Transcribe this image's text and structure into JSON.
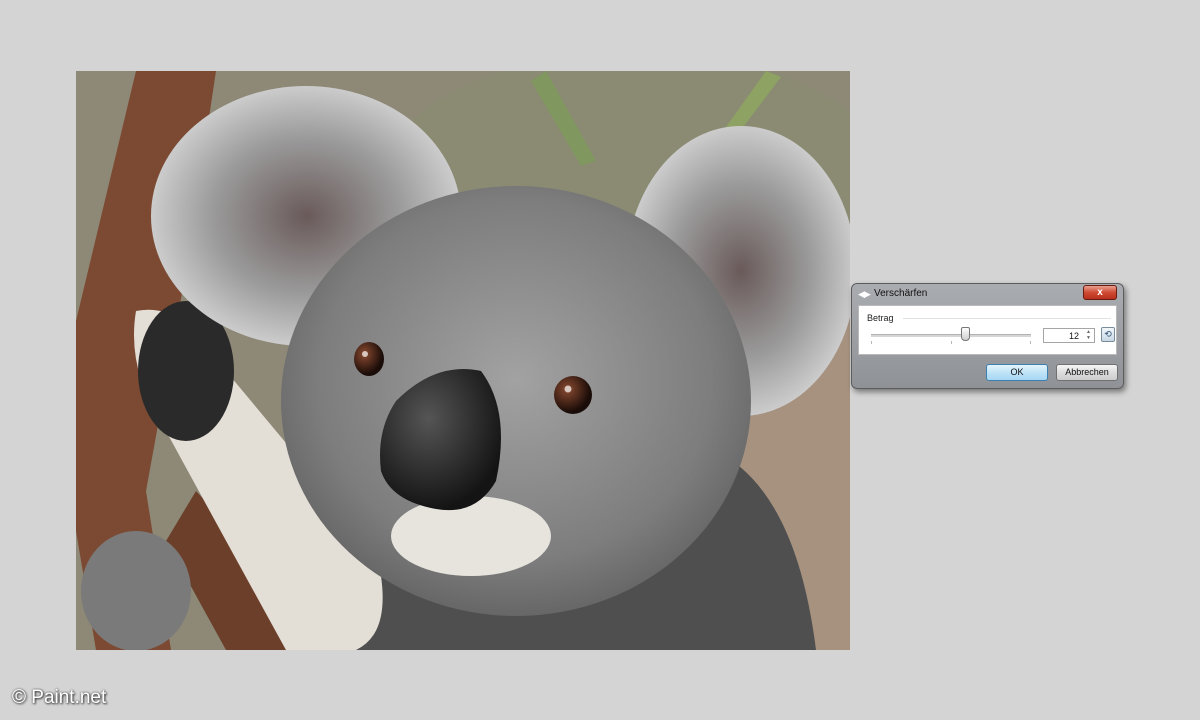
{
  "dialog": {
    "title": "Verschärfen",
    "title_icon": "sharpen-icon",
    "close_label": "x",
    "amount_label": "Betrag",
    "amount_value": "12",
    "amount_fraction": 0.59,
    "reset_icon": "reset-icon",
    "ok_label": "OK",
    "cancel_label": "Abbrechen"
  },
  "canvas": {
    "image_subject": "koala photo"
  },
  "watermark": "© Paint.net",
  "colors": {
    "background": "#d4d4d4",
    "close_button": "#cf4a33",
    "ok_button": "#bfe3f7"
  }
}
